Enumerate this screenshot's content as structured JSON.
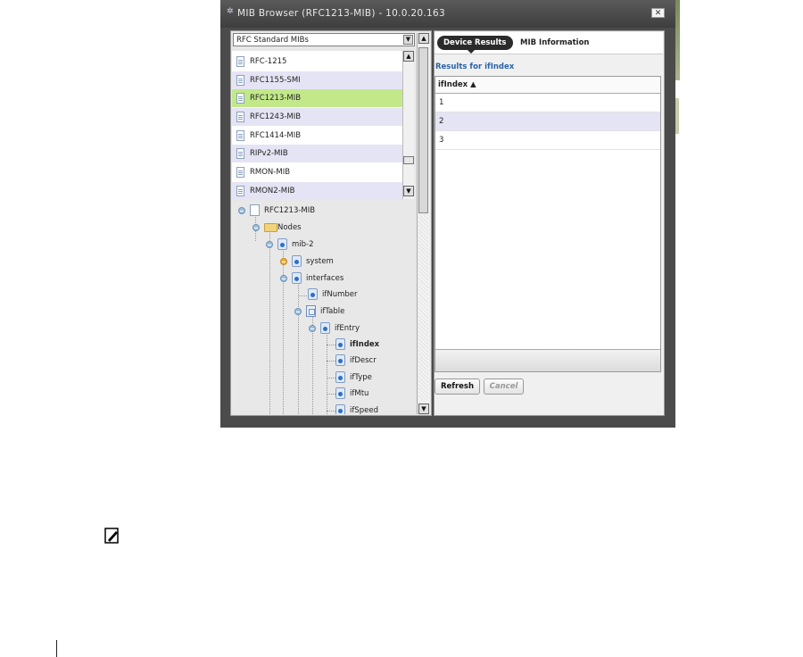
{
  "window": {
    "title": "MIB Browser (RFC1213-MIB) - 10.0.20.163",
    "close_label": "✕"
  },
  "left": {
    "combo_value": "RFC Standard MIBs",
    "mib_list": [
      {
        "label": "RFC-1215",
        "selected": false
      },
      {
        "label": "RFC1155-SMI",
        "selected": false
      },
      {
        "label": "RFC1213-MIB",
        "selected": true
      },
      {
        "label": "RFC1243-MIB",
        "selected": false
      },
      {
        "label": "RFC1414-MIB",
        "selected": false
      },
      {
        "label": "RIPv2-MIB",
        "selected": false
      },
      {
        "label": "RMON-MIB",
        "selected": false
      },
      {
        "label": "RMON2-MIB",
        "selected": false
      }
    ],
    "tree": [
      {
        "label": "RFC1213-MIB",
        "icon": "document-icon"
      },
      {
        "label": "Nodes",
        "icon": "folder-icon"
      },
      {
        "label": "mib-2",
        "icon": "leaf-node-icon"
      },
      {
        "label": "system",
        "icon": "leaf-node-icon"
      },
      {
        "label": "interfaces",
        "icon": "leaf-node-icon"
      },
      {
        "label": "ifNumber",
        "icon": "leaf-node-icon"
      },
      {
        "label": "ifTable",
        "icon": "table-icon"
      },
      {
        "label": "ifEntry",
        "icon": "leaf-node-icon"
      },
      {
        "label": "ifIndex",
        "icon": "leaf-node-icon",
        "selected": true
      },
      {
        "label": "ifDescr",
        "icon": "leaf-node-icon"
      },
      {
        "label": "ifType",
        "icon": "leaf-node-icon"
      },
      {
        "label": "ifMtu",
        "icon": "leaf-node-icon"
      },
      {
        "label": "ifSpeed",
        "icon": "leaf-node-icon"
      }
    ]
  },
  "right": {
    "tabs": [
      {
        "label": "Device Results",
        "active": true
      },
      {
        "label": "MIB Information",
        "active": false
      }
    ],
    "results_title": "Results for ifIndex",
    "table": {
      "column": "ifIndex ▲",
      "rows": [
        "1",
        "2",
        "3"
      ]
    },
    "refresh_label": "Refresh",
    "cancel_label": "Cancel"
  },
  "colors": {
    "selected_row": "#c2e88a",
    "alt_row": "#e4e4f4",
    "title_blue": "#2a63a8",
    "tab_active": "#2b2b2b"
  }
}
